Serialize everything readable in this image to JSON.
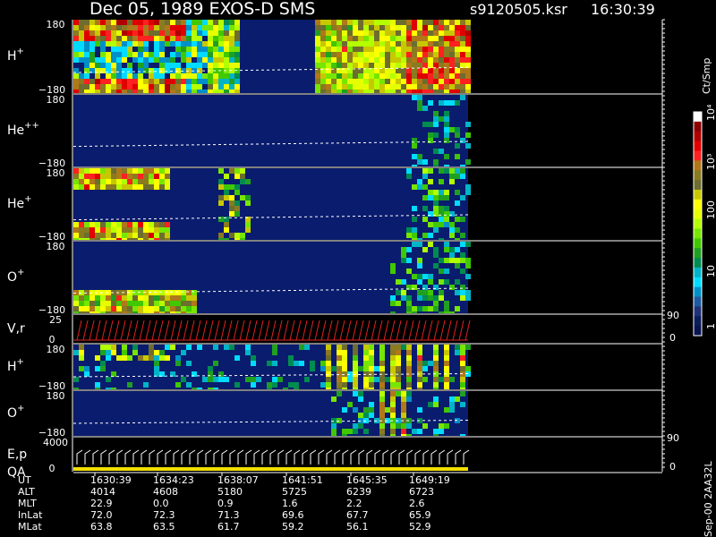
{
  "header": {
    "title": "Dec 05, 1989   EXOS-D SMS",
    "file": "s9120505.ksr",
    "time": "16:30:39"
  },
  "panels": [
    {
      "label": "H",
      "sup": "+",
      "ymax": "180",
      "ymin": "−180"
    },
    {
      "label": "He",
      "sup": "++",
      "ymax": "180",
      "ymin": "−180"
    },
    {
      "label": "He",
      "sup": "+",
      "ymax": "180",
      "ymin": "−180"
    },
    {
      "label": "O",
      "sup": "+",
      "ymax": "180",
      "ymin": "−180"
    },
    {
      "label": "V,r",
      "sup": "",
      "ymax": "25",
      "ymin": "0",
      "rmax": "90",
      "rmin": "0"
    },
    {
      "label": "H",
      "sup": "+",
      "ymax": "180",
      "ymin": "−180"
    },
    {
      "label": "O",
      "sup": "+",
      "ymax": "180",
      "ymin": "−180"
    },
    {
      "label": "E,p",
      "sup": "",
      "label2": "QA",
      "ymax": "4000",
      "ymin": "0",
      "rmax": "90",
      "rmin": "0"
    }
  ],
  "colorbar": {
    "unit": "Ct/Smp",
    "labels": [
      "10⁴",
      "10³",
      "100",
      "10",
      "1"
    ],
    "colors": [
      "#ffffff",
      "#8b0000",
      "#b00000",
      "#e00000",
      "#ff2020",
      "#b07818",
      "#8a7a20",
      "#6d6d2e",
      "#c8c800",
      "#ffff00",
      "#e6ff00",
      "#b4ff00",
      "#78e600",
      "#40c800",
      "#20a020",
      "#008c50",
      "#00b4c8",
      "#00dcff",
      "#0090c8",
      "#1e5aa0",
      "#1e3278",
      "#0a1e5a",
      "#0a1450"
    ]
  },
  "footer": {
    "rows": [
      {
        "label": "UT",
        "values": [
          "1630:39",
          "1634:23",
          "1638:07",
          "1641:51",
          "1645:35",
          "1649:19"
        ]
      },
      {
        "label": "ALT",
        "values": [
          "4014",
          "4608",
          "5180",
          "5725",
          "6239",
          "6723"
        ]
      },
      {
        "label": "MLT",
        "values": [
          "22.9",
          "0.0",
          "0.9",
          "1.6",
          "2.2",
          "2.6"
        ]
      },
      {
        "label": "InLat",
        "values": [
          "72.0",
          "72.3",
          "71.3",
          "69.6",
          "67.7",
          "65.9"
        ]
      },
      {
        "label": "MLat",
        "values": [
          "63.8",
          "63.5",
          "61.7",
          "59.2",
          "56.1",
          "52.9"
        ]
      }
    ],
    "code": "Sep-00  2AA32L"
  },
  "chart_data": {
    "type": "heatmap",
    "title": "Dec 05, 1989   EXOS-D SMS",
    "x_ticks": [
      "1630:39",
      "1634:23",
      "1638:07",
      "1641:51",
      "1645:35",
      "1649:19"
    ],
    "series": [
      {
        "name": "H+",
        "y_range": [
          -180,
          180
        ]
      },
      {
        "name": "He++",
        "y_range": [
          -180,
          180
        ]
      },
      {
        "name": "He+",
        "y_range": [
          -180,
          180
        ]
      },
      {
        "name": "O+",
        "y_range": [
          -180,
          180
        ]
      },
      {
        "name": "V,r",
        "y_range": [
          0,
          25
        ],
        "right_range": [
          0,
          90
        ]
      },
      {
        "name": "H+",
        "y_range": [
          -180,
          180
        ]
      },
      {
        "name": "O+",
        "y_range": [
          -180,
          180
        ]
      },
      {
        "name": "E,p",
        "y_range": [
          0,
          4000
        ],
        "right_range": [
          0,
          90
        ]
      }
    ],
    "colorbar_unit": "Ct/Smp",
    "colorbar_range": [
      1,
      10000
    ],
    "grid": false
  }
}
